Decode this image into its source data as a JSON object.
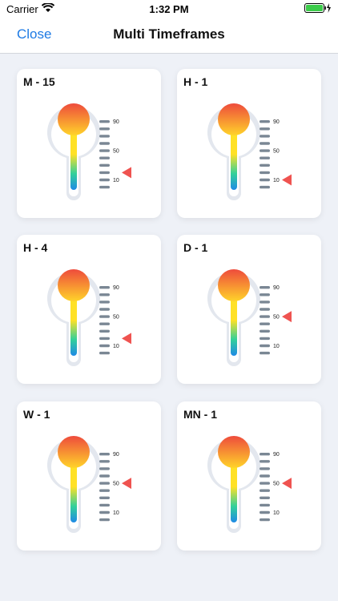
{
  "status": {
    "carrier": "Carrier",
    "time": "1:32 PM"
  },
  "nav": {
    "close_label": "Close",
    "title": "Multi Timeframes"
  },
  "scale_labels": [
    "90",
    "50",
    "10"
  ],
  "colors": {
    "accent": "#1d7ae4",
    "pointer": "#ef5350",
    "tick": "#7a8794",
    "bulb_top": "#ee4b3c",
    "bulb_bottom": "#ffd42a",
    "tube_top": "#ffe126",
    "tube_bottom": "#1f8ae6"
  },
  "cards": [
    {
      "label": "M - 15",
      "level": 20
    },
    {
      "label": "H - 1",
      "level": 10
    },
    {
      "label": "H - 4",
      "level": 20
    },
    {
      "label": "D - 1",
      "level": 50
    },
    {
      "label": "W - 1",
      "level": 50
    },
    {
      "label": "MN - 1",
      "level": 50
    }
  ]
}
